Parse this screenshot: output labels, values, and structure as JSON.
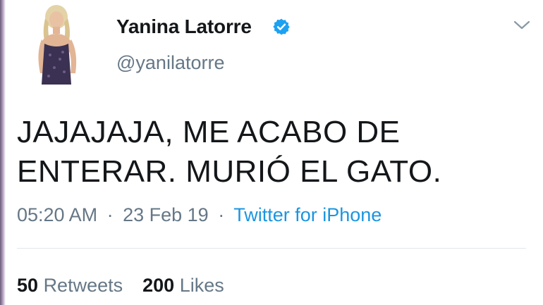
{
  "tweet": {
    "display_name": "Yanina Latorre",
    "handle": "@yanilatorre",
    "verified_icon": "verified-badge-icon",
    "menu_icon": "chevron-down-icon",
    "text": "JAJAJAJA, ME ACABO DE\nENTERAR. MURIÓ EL GATO.",
    "time": "05:20 AM",
    "date": "23 Feb 19",
    "separator": "·",
    "source": "Twitter for iPhone",
    "stats": {
      "retweets_count": "50",
      "retweets_label": "Retweets",
      "likes_count": "200",
      "likes_label": "Likes"
    }
  },
  "colors": {
    "verified_blue": "#1da1f2",
    "link_blue": "#1b95e0",
    "secondary_text": "#657786",
    "primary_text": "#14171a",
    "divider": "#e1e8ed"
  }
}
